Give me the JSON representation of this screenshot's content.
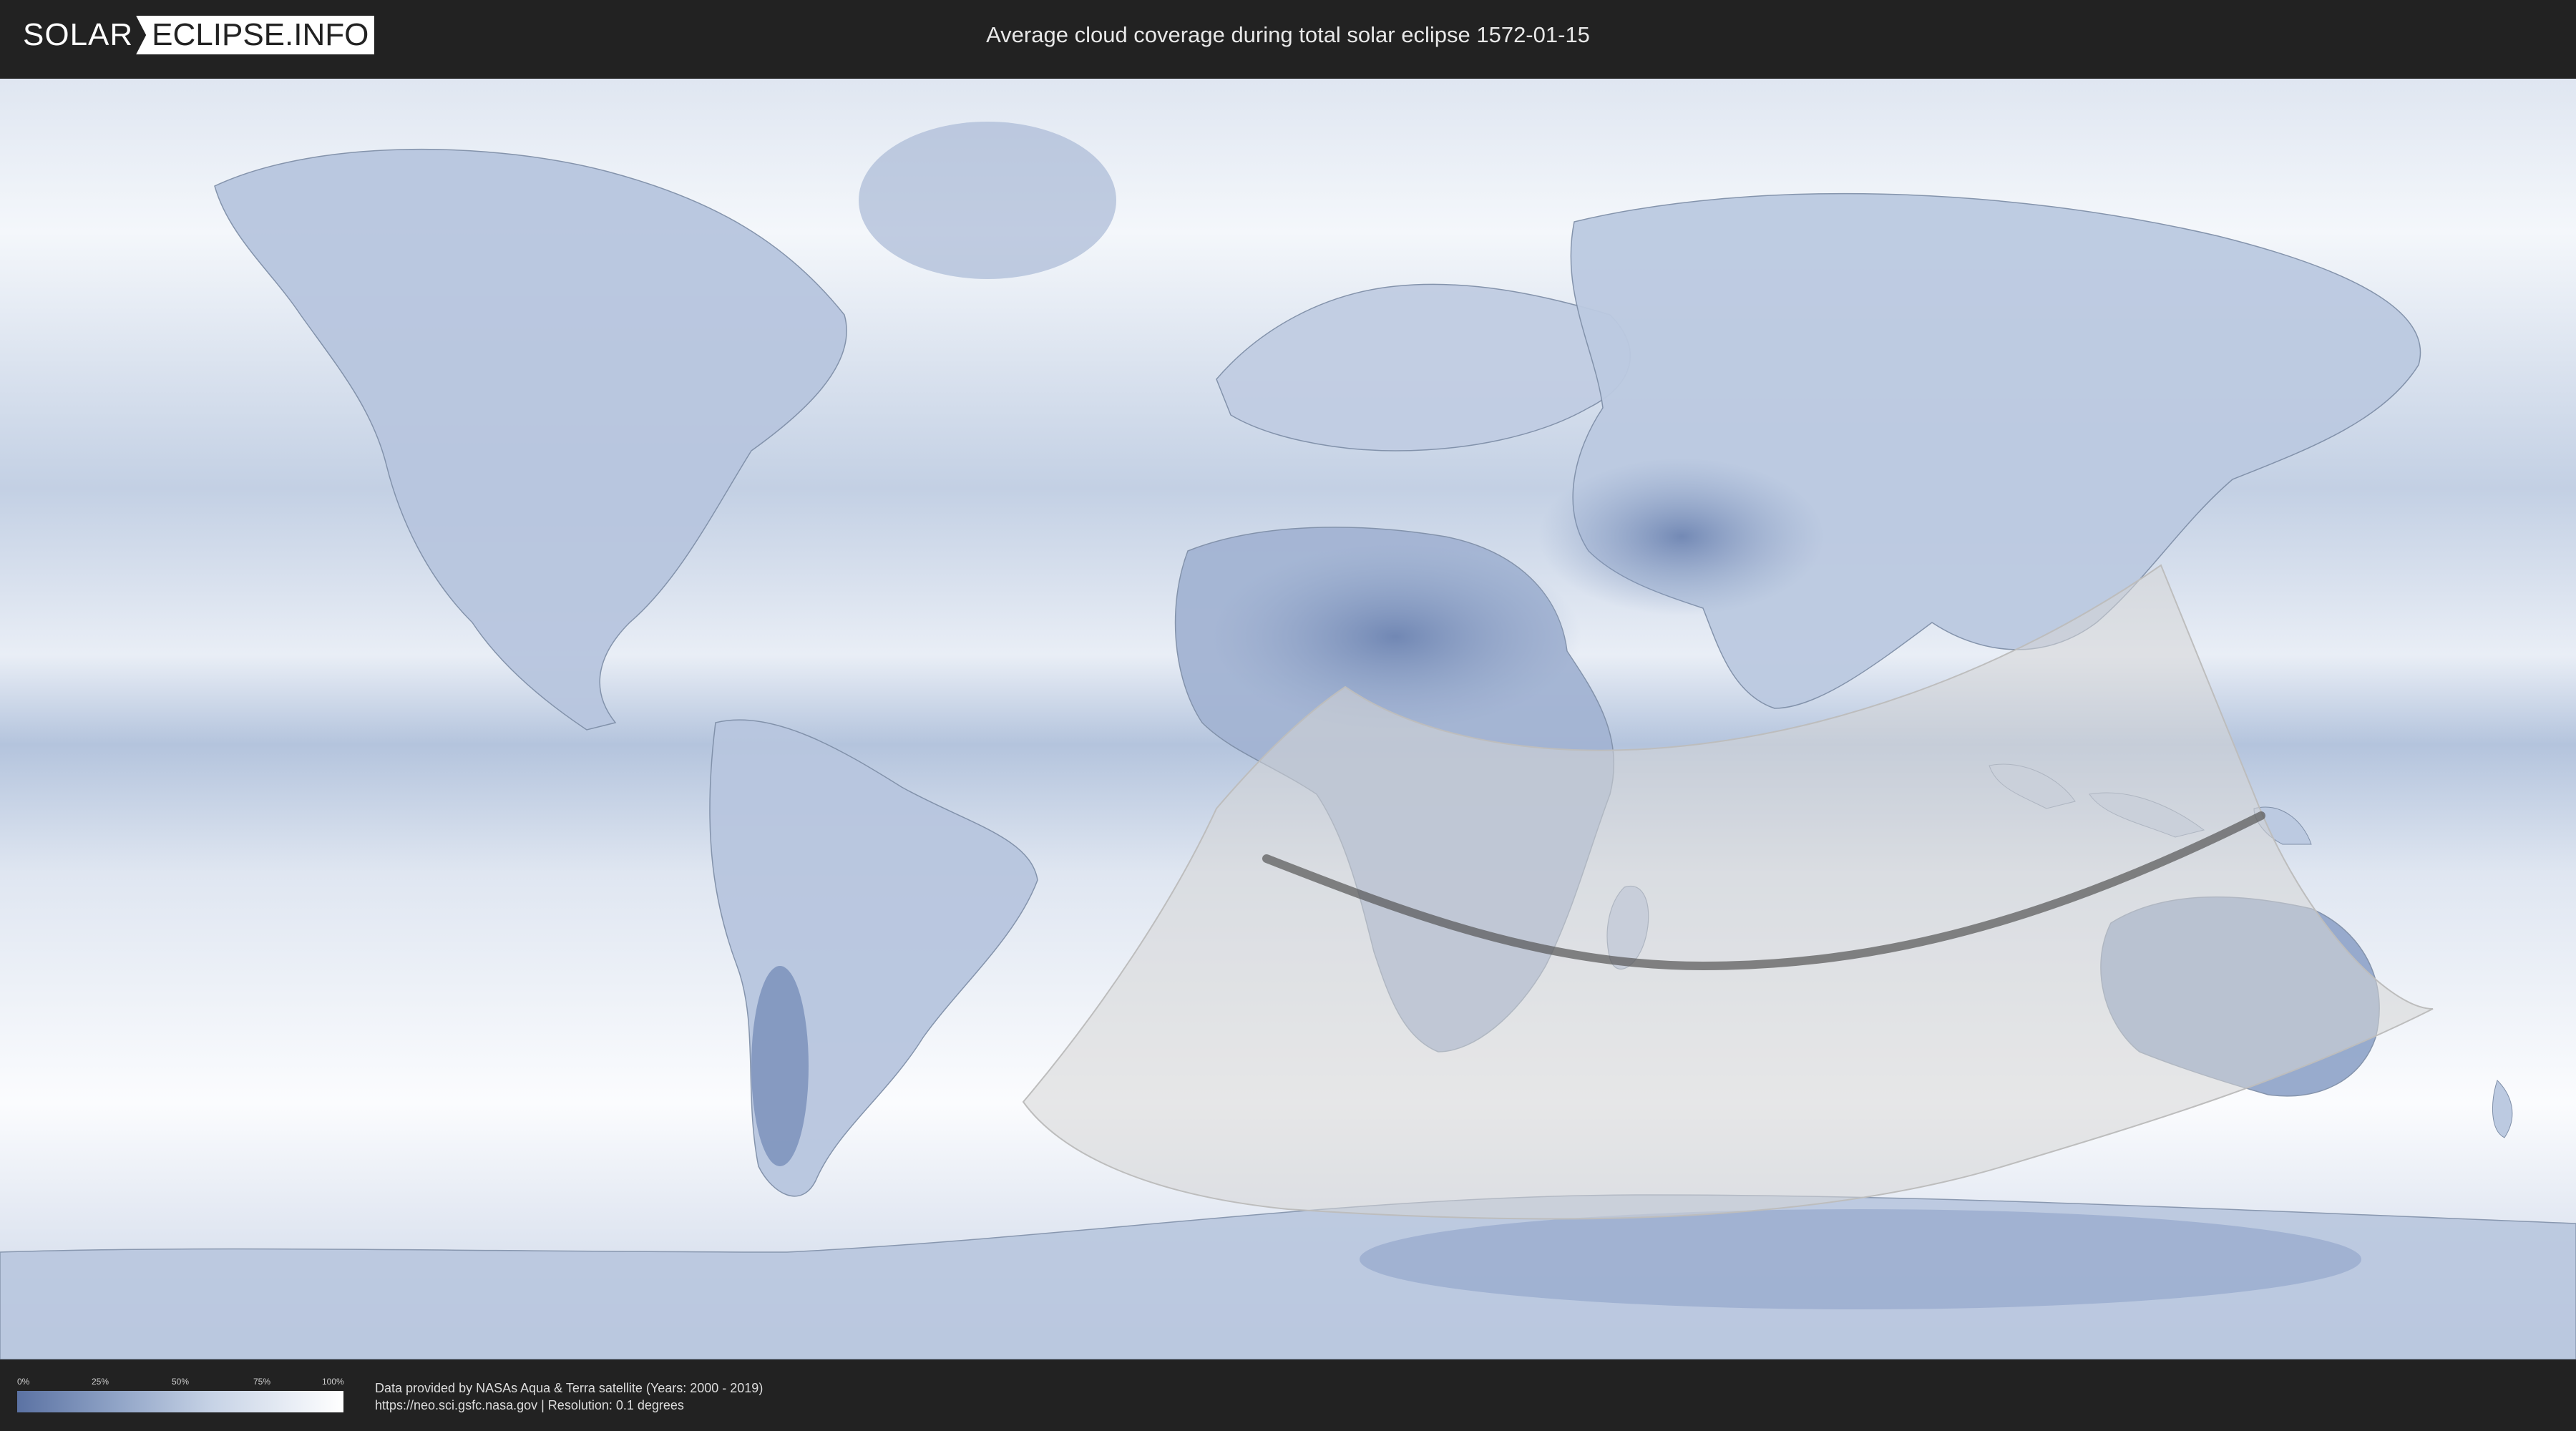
{
  "header": {
    "logo_solar": "SOLAR",
    "logo_eclipse": "ECLIPSE.INFO",
    "title": "Average cloud coverage during total solar eclipse 1572-01-15"
  },
  "map": {
    "type": "world-cloud-coverage",
    "projection": "equirectangular",
    "colors": {
      "ocean_cloudy": "#ffffff",
      "clear_sky": "#5b72a3",
      "mid": "#a9b9d6",
      "eclipse_overlay": "#d9d9d9",
      "central_line": "#555555"
    },
    "features": [
      "eclipse-visibility-region",
      "totality-central-line"
    ]
  },
  "legend": {
    "ticks": [
      "0%",
      "25%",
      "50%",
      "75%",
      "100%"
    ],
    "gradient": [
      "#5b72a3",
      "#8fa3c6",
      "#c7d3e6",
      "#ffffff"
    ]
  },
  "credits": {
    "line1": "Data provided by NASAs Aqua & Terra satellite (Years: 2000 - 2019)",
    "line2": "https://neo.sci.gsfc.nasa.gov | Resolution: 0.1 degrees"
  }
}
